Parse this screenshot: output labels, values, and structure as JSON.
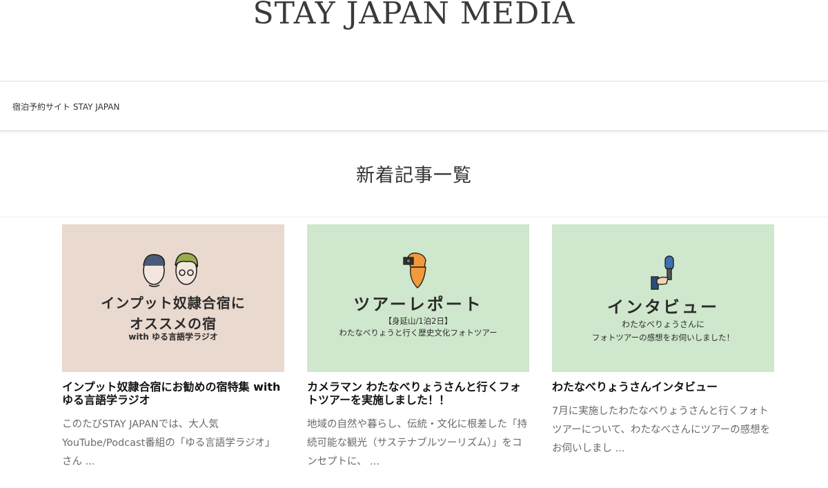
{
  "site": {
    "title": "STAY JAPAN MEDIA"
  },
  "nav": {
    "link_label": "宿泊予約サイト STAY JAPAN"
  },
  "section": {
    "title": "新着記事一覧"
  },
  "cards": [
    {
      "thumb_line1": "インプット奴隷合宿に",
      "thumb_line2": "オススメの宿",
      "thumb_line3": "with ゆる言語学ラジオ",
      "title": "インプット奴隷合宿にお勧めの宿特集 with ゆる言語学ラジオ",
      "excerpt": "このたびSTAY JAPANでは、大人気YouTube/Podcast番組の「ゆる言語学ラジオ」さん ..."
    },
    {
      "thumb_line1": "ツアーレポート",
      "thumb_line2": "【身延山/1泊2日】",
      "thumb_line3": "わたなべりょうと行く歴史文化フォトツアー",
      "title": "カメラマン わたなべりょうさんと行くフォトツアーを実施しました！！",
      "excerpt": "地域の自然や暮らし、伝統・文化に根差した「持続可能な観光（サステナブルツーリズム）」をコンセプトに、 ..."
    },
    {
      "thumb_line1": "インタビュー",
      "thumb_line2": "わたなべりょうさんに",
      "thumb_line3": "フォトツアーの感想をお伺いしました！",
      "title": "わたなべりょうさんインタビュー",
      "excerpt": "7月に実施したわたなべりょうさんと行くフォトツアーについて、わたなべさんにツアーの感想をお伺いしまし ..."
    }
  ]
}
